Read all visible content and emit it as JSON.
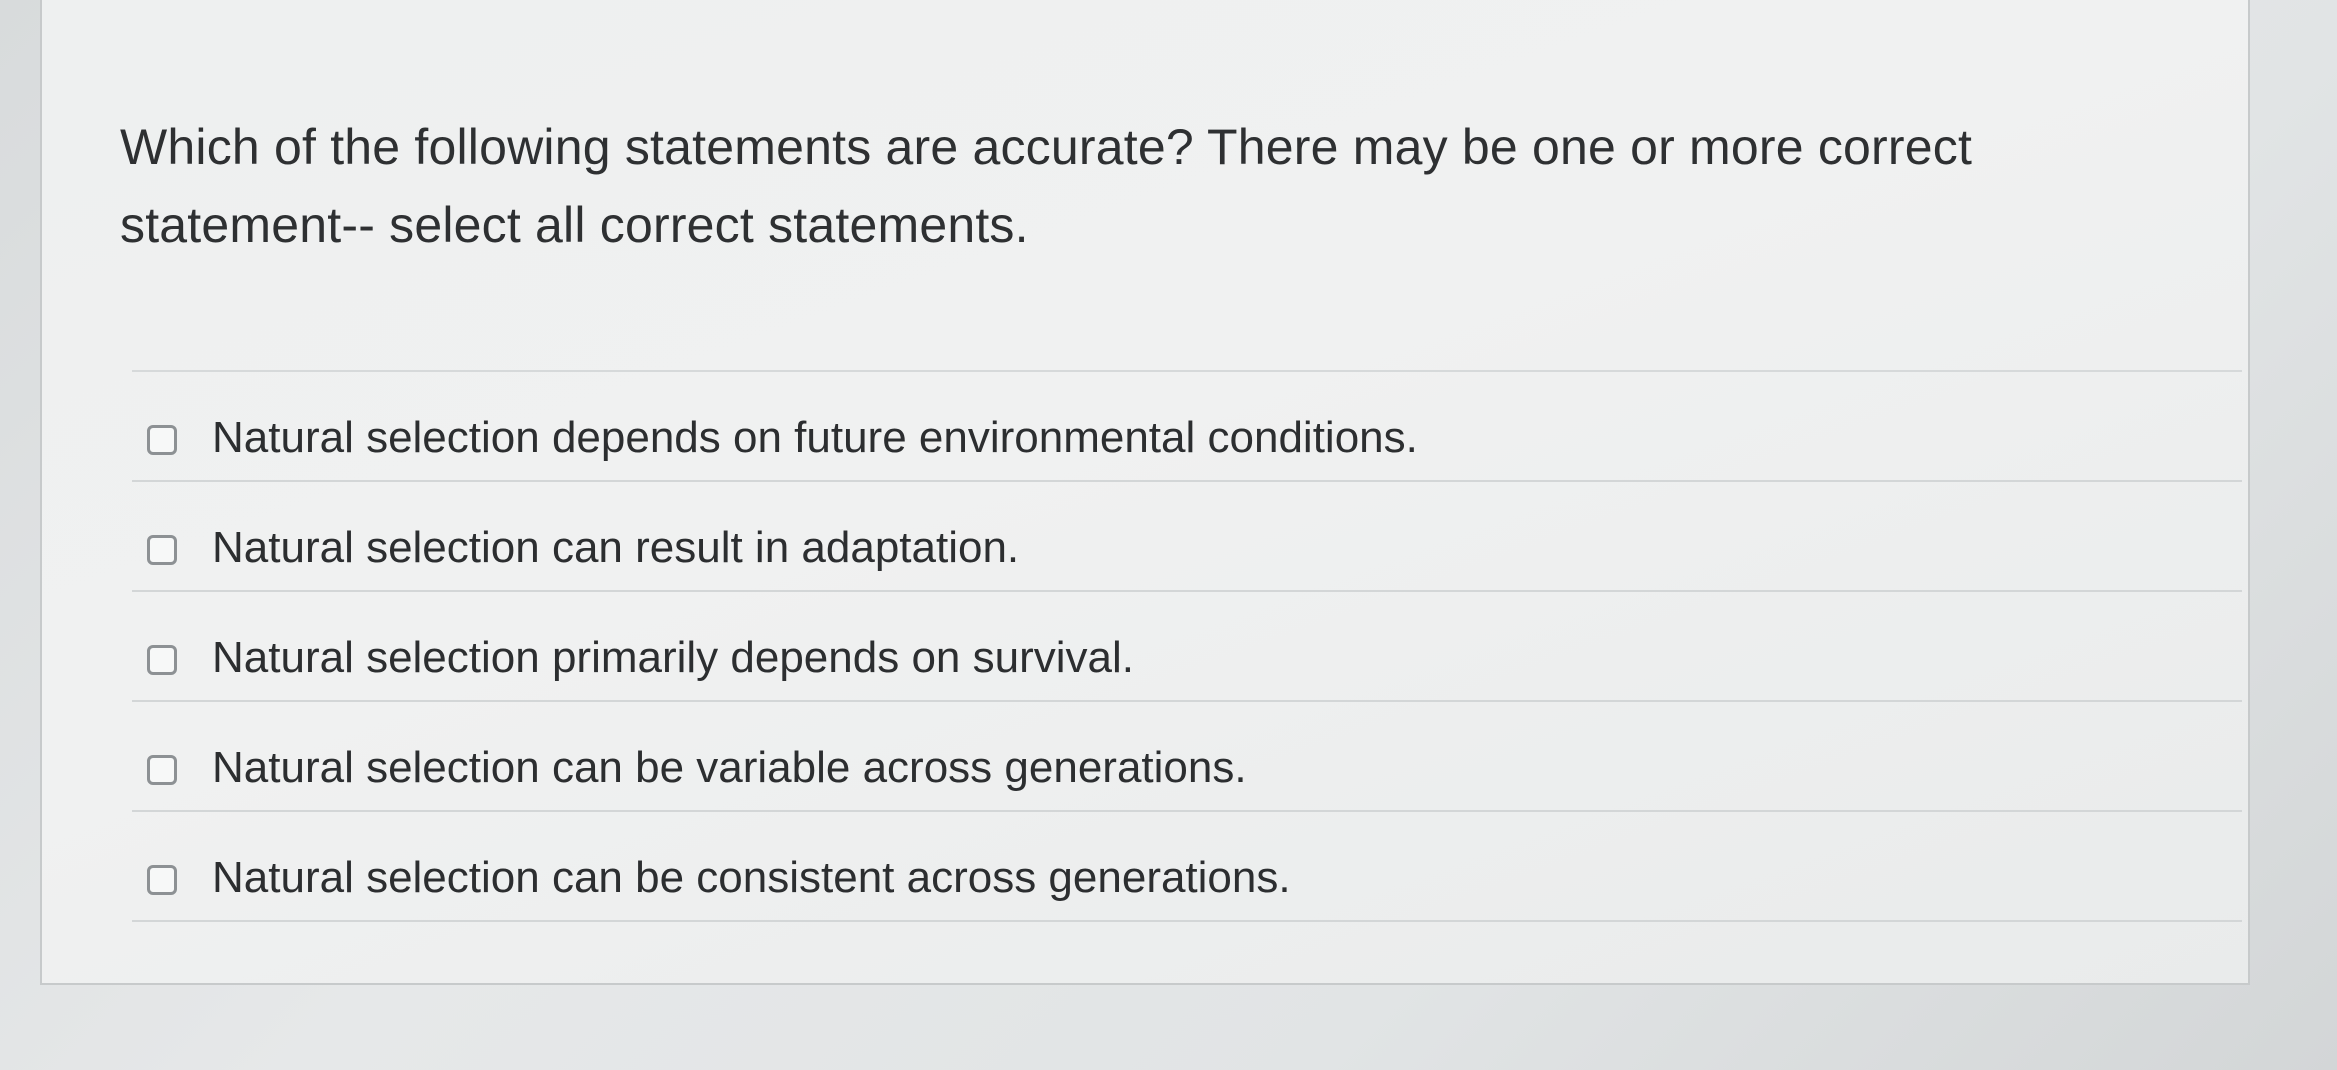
{
  "question": {
    "text": "Which of the following statements are accurate? There may be one or more correct statement-- select all correct statements."
  },
  "options": [
    {
      "label": "Natural selection depends on future environmental conditions.",
      "checked": false
    },
    {
      "label": "Natural selection can result in adaptation.",
      "checked": false
    },
    {
      "label": "Natural selection primarily depends on survival.",
      "checked": false
    },
    {
      "label": "Natural selection can be variable across generations.",
      "checked": false
    },
    {
      "label": "Natural selection can be consistent across generations.",
      "checked": false
    }
  ]
}
